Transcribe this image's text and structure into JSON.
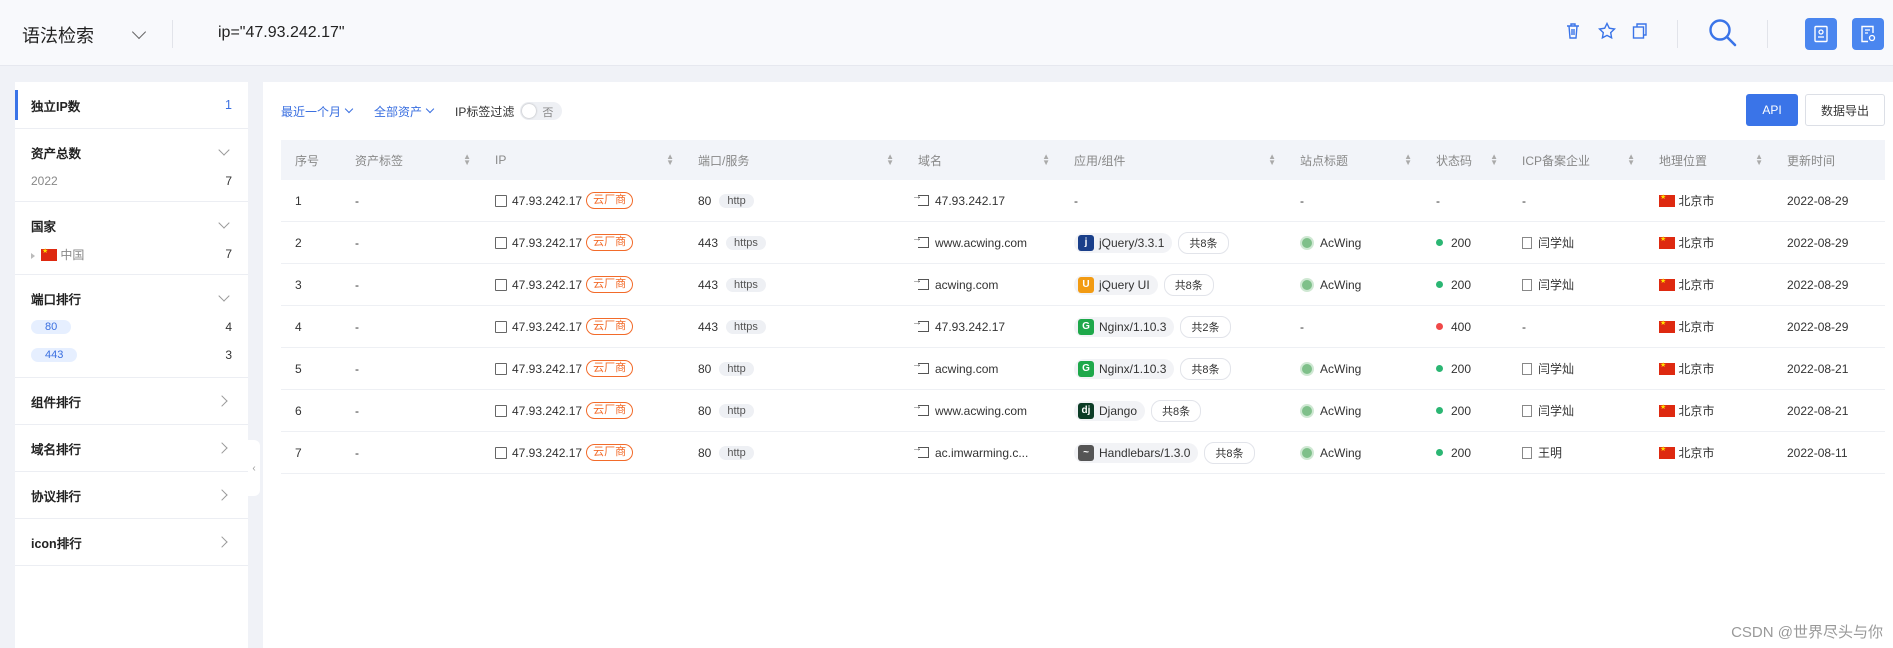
{
  "header": {
    "mode": "语法检索",
    "query": "ip=\"47.93.242.17\""
  },
  "sidebar": {
    "unique_ip": {
      "label": "独立IP数",
      "count": "1"
    },
    "total_assets": {
      "label": "资产总数",
      "items": [
        {
          "name": "2022",
          "count": "7"
        }
      ]
    },
    "country": {
      "label": "国家",
      "items": [
        {
          "name": "中国",
          "count": "7"
        }
      ]
    },
    "port_rank": {
      "label": "端口排行",
      "items": [
        {
          "name": "80",
          "count": "4"
        },
        {
          "name": "443",
          "count": "3"
        }
      ]
    },
    "component_rank": "组件排行",
    "domain_rank": "域名排行",
    "protocol_rank": "协议排行",
    "icon_rank": "icon排行"
  },
  "filters": {
    "time": "最近一个月",
    "assets": "全部资产",
    "ip_tag_filter": "IP标签过滤",
    "toggle_value": "否"
  },
  "actions": {
    "api": "API",
    "export": "数据导出"
  },
  "table": {
    "columns": [
      "序号",
      "资产标签",
      "IP",
      "端口/服务",
      "域名",
      "应用/组件",
      "站点标题",
      "状态码",
      "ICP备案企业",
      "地理位置",
      "更新时间"
    ],
    "cloud_tag": "云厂商",
    "rows": [
      {
        "no": "1",
        "tag": "-",
        "ip": "47.93.242.17",
        "port": "80",
        "service": "http",
        "domain": "47.93.242.17",
        "component": "-",
        "more": "",
        "title": "-",
        "status": "-",
        "icp": "-",
        "location": "北京市",
        "updated": "2022-08-29"
      },
      {
        "no": "2",
        "tag": "-",
        "ip": "47.93.242.17",
        "port": "443",
        "service": "https",
        "domain": "www.acwing.com",
        "component": "jQuery/3.3.1",
        "more": "共8条",
        "title": "AcWing",
        "status": "200",
        "icp": "闫学灿",
        "location": "北京市",
        "updated": "2022-08-29"
      },
      {
        "no": "3",
        "tag": "-",
        "ip": "47.93.242.17",
        "port": "443",
        "service": "https",
        "domain": "acwing.com",
        "component": "jQuery UI",
        "more": "共8条",
        "title": "AcWing",
        "status": "200",
        "icp": "闫学灿",
        "location": "北京市",
        "updated": "2022-08-29"
      },
      {
        "no": "4",
        "tag": "-",
        "ip": "47.93.242.17",
        "port": "443",
        "service": "https",
        "domain": "47.93.242.17",
        "component": "Nginx/1.10.3",
        "more": "共2条",
        "title": "-",
        "status": "400",
        "icp": "-",
        "location": "北京市",
        "updated": "2022-08-29"
      },
      {
        "no": "5",
        "tag": "-",
        "ip": "47.93.242.17",
        "port": "80",
        "service": "http",
        "domain": "acwing.com",
        "component": "Nginx/1.10.3",
        "more": "共8条",
        "title": "AcWing",
        "status": "200",
        "icp": "闫学灿",
        "location": "北京市",
        "updated": "2022-08-21"
      },
      {
        "no": "6",
        "tag": "-",
        "ip": "47.93.242.17",
        "port": "80",
        "service": "http",
        "domain": "www.acwing.com",
        "component": "Django",
        "more": "共8条",
        "title": "AcWing",
        "status": "200",
        "icp": "闫学灿",
        "location": "北京市",
        "updated": "2022-08-21"
      },
      {
        "no": "7",
        "tag": "-",
        "ip": "47.93.242.17",
        "port": "80",
        "service": "http",
        "domain": "ac.imwarming.c...",
        "component": "Handlebars/1.3.0",
        "more": "共8条",
        "title": "AcWing",
        "status": "200",
        "icp": "王明",
        "location": "北京市",
        "updated": "2022-08-11"
      }
    ]
  },
  "watermark": "CSDN @世界尽头与你",
  "colors": {
    "accent": "#3a74e8",
    "cloud": "#f26b2a",
    "ok": "#2bb673",
    "error": "#f04848"
  }
}
